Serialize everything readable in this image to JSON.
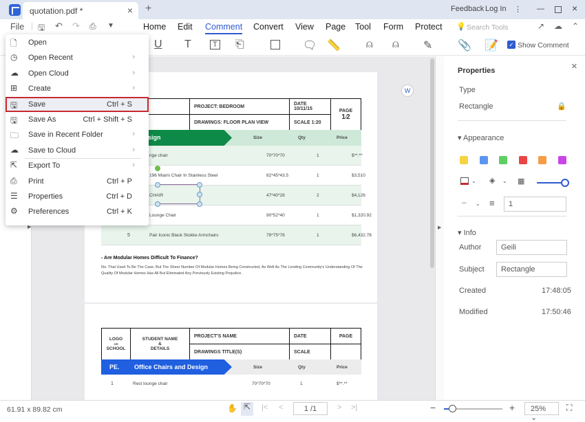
{
  "window": {
    "tab_title": "quotation.pdf *",
    "feedback": "Feedback",
    "login": "Log In"
  },
  "menubar": {
    "file": "File",
    "tabs": [
      "Home",
      "Edit",
      "Comment",
      "Convert",
      "View",
      "Page",
      "Tool",
      "Form",
      "Protect"
    ],
    "active_tab": "Comment",
    "search_placeholder": "Search Tools"
  },
  "toolbar": {
    "show_comment": "Show Comment",
    "show_comment_checked": true
  },
  "file_menu": [
    {
      "label": "Open",
      "icon": "file-icon"
    },
    {
      "label": "Open Recent",
      "icon": "clock-icon",
      "submenu": true
    },
    {
      "label": "Open Cloud",
      "icon": "cloud-icon",
      "submenu": true
    },
    {
      "label": "Create",
      "icon": "plus-file-icon",
      "submenu": true
    },
    {
      "label": "Save",
      "icon": "save-icon",
      "shortcut": "Ctrl + S",
      "selected": true
    },
    {
      "label": "Save As",
      "icon": "save-as-icon",
      "shortcut": "Ctrl + Shift + S"
    },
    {
      "label": "Save in Recent Folder",
      "icon": "folder-icon",
      "submenu": true
    },
    {
      "label": "Save to Cloud",
      "icon": "cloud-upload-icon",
      "submenu": true
    },
    {
      "label": "Export To",
      "icon": "export-icon",
      "submenu": true
    },
    {
      "label": "Print",
      "icon": "print-icon",
      "shortcut": "Ctrl + P"
    },
    {
      "label": "Properties",
      "icon": "list-icon",
      "shortcut": "Ctrl + D"
    },
    {
      "label": "Preferences",
      "icon": "settings-icon",
      "shortcut": "Ctrl + K"
    }
  ],
  "doc": {
    "page1": {
      "name1": "e Surname",
      "name2": "me Surname",
      "project": "PROJECT: BEDROOM",
      "drawings": "DRAWINGS: FLOOR PLAN VIEW",
      "date": "DATE 10/11/15",
      "scale": "SCALE 1:20",
      "page_label": "PAGE",
      "page_num": "1",
      "page_total": "2",
      "band": "e Chairs and Design",
      "cols": [
        "Size",
        "Qty",
        "Price"
      ],
      "rows": [
        [
          "",
          "nge chair",
          "70*70*70",
          "1",
          "$**.**"
        ],
        [
          "",
          "196 Miami Chair In Stainless Steel",
          "82*45*43.5",
          "1",
          "$3,510"
        ],
        [
          "",
          "CHAIR",
          "47*40*28",
          "2",
          "$4,126"
        ],
        [
          "",
          "Lounge Chair",
          "90*52*40",
          "1",
          "$1,320.92"
        ],
        [
          "5",
          "Pair Iconic Black Stokke Armchairs",
          "79*75*76",
          "1",
          "$6,432.78"
        ]
      ],
      "question": "- Are Modular Homes Difficult To Finance?",
      "para": "No. That Used To Be The Case, But The Sheer Number Of Modular Homes Being Constructed, As Well As The Lending Community's Understanding Of The Quality Of Modular Homes Has All But Eliminated Any Previously Existing Prejudice."
    },
    "page2": {
      "logo": "LOGO",
      "or": "OR",
      "school": "SCHOOL",
      "student": "STUDENT NAME",
      "amp": "&",
      "details": "DETAILS",
      "project": "PROJECT'S NAME",
      "drawings": "DRAWINGS TITLE(S)",
      "date": "DATE",
      "scale": "SCALE",
      "page_label": "PAGE",
      "pe": "PE.",
      "band": "Office Chairs and Design",
      "cols": [
        "Size",
        "Qty",
        "Price"
      ],
      "rows": [
        [
          "1",
          "Rest lounge chair",
          "70*70*70",
          "1",
          "$**.**"
        ]
      ]
    }
  },
  "properties": {
    "title": "Properties",
    "type_label": "Type",
    "type_value": "Rectangle",
    "appearance": "Appearance",
    "swatches": [
      "#f5d442",
      "#5b95f0",
      "#5fcf62",
      "#e94545",
      "#f59e45",
      "#c945e9"
    ],
    "stroke_color": "#c8282e",
    "opacity": 100,
    "line_width": "1",
    "info": "Info",
    "author_label": "Author",
    "author": "Geili",
    "subject_label": "Subject",
    "subject": "Rectangle",
    "created_label": "Created",
    "created": "17:48:05",
    "modified_label": "Modified",
    "modified": "17:50:46"
  },
  "status": {
    "dimensions": "61.91 x 89.82 cm",
    "page_input": "1 /1",
    "zoom": "25%"
  },
  "colors": {
    "accent": "#2f5bd0",
    "green_band": "#0e8a48",
    "blue_band": "#1f5fe0"
  }
}
